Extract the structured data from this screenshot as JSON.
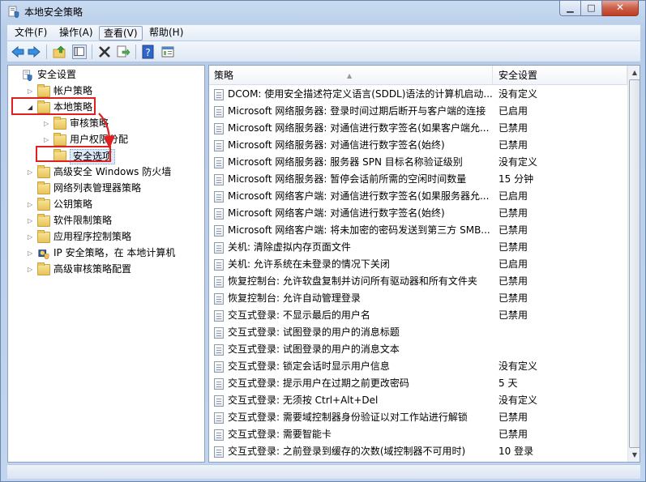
{
  "window": {
    "title": "本地安全策略"
  },
  "menu": [
    {
      "label": "文件(F)",
      "selected": false
    },
    {
      "label": "操作(A)",
      "selected": false
    },
    {
      "label": "查看(V)",
      "selected": true
    },
    {
      "label": "帮助(H)",
      "selected": false
    }
  ],
  "toolbar": {
    "icons": [
      "back-arrow-icon",
      "forward-arrow-icon",
      "up-folder-icon",
      "show-hide-tree-icon",
      "delete-icon",
      "export-list-icon",
      "help-icon",
      "properties-icon"
    ]
  },
  "tree": [
    {
      "label": "安全设置",
      "icon": "security-settings-icon",
      "arrow": "",
      "level": 0
    },
    {
      "label": "帐户策略",
      "icon": "folder-icon",
      "arrow": "collapsed",
      "level": 1
    },
    {
      "label": "本地策略",
      "icon": "folder-open-icon",
      "arrow": "expanded",
      "level": 1,
      "highlighted": true
    },
    {
      "label": "审核策略",
      "icon": "folder-icon",
      "arrow": "collapsed",
      "level": 2
    },
    {
      "label": "用户权限分配",
      "icon": "folder-icon",
      "arrow": "collapsed",
      "level": 2
    },
    {
      "label": "安全选项",
      "icon": "folder-open-icon",
      "arrow": "",
      "level": 2,
      "selected": true,
      "highlighted": true
    },
    {
      "label": "高级安全 Windows 防火墙",
      "icon": "folder-icon",
      "arrow": "collapsed",
      "level": 1
    },
    {
      "label": "网络列表管理器策略",
      "icon": "folder-icon",
      "arrow": "",
      "level": 1
    },
    {
      "label": "公钥策略",
      "icon": "folder-icon",
      "arrow": "collapsed",
      "level": 1
    },
    {
      "label": "软件限制策略",
      "icon": "folder-icon",
      "arrow": "collapsed",
      "level": 1
    },
    {
      "label": "应用程序控制策略",
      "icon": "folder-icon",
      "arrow": "collapsed",
      "level": 1
    },
    {
      "label": "IP 安全策略，在 本地计算机",
      "icon": "ip-security-icon",
      "arrow": "collapsed",
      "level": 1
    },
    {
      "label": "高级审核策略配置",
      "icon": "folder-icon",
      "arrow": "collapsed",
      "level": 1
    }
  ],
  "table": {
    "columns": [
      "策略",
      "安全设置"
    ],
    "rows": [
      [
        "DCOM: 使用安全描述符定义语言(SDDL)语法的计算机启动...",
        "没有定义"
      ],
      [
        "Microsoft 网络服务器: 登录时间过期后断开与客户端的连接",
        "已启用"
      ],
      [
        "Microsoft 网络服务器: 对通信进行数字签名(如果客户端允...",
        "已禁用"
      ],
      [
        "Microsoft 网络服务器: 对通信进行数字签名(始终)",
        "已禁用"
      ],
      [
        "Microsoft 网络服务器: 服务器 SPN 目标名称验证级别",
        "没有定义"
      ],
      [
        "Microsoft 网络服务器: 暂停会话前所需的空闲时间数量",
        "15 分钟"
      ],
      [
        "Microsoft 网络客户端: 对通信进行数字签名(如果服务器允...",
        "已启用"
      ],
      [
        "Microsoft 网络客户端: 对通信进行数字签名(始终)",
        "已禁用"
      ],
      [
        "Microsoft 网络客户端: 将未加密的密码发送到第三方 SMB...",
        "已禁用"
      ],
      [
        "关机: 清除虚拟内存页面文件",
        "已禁用"
      ],
      [
        "关机: 允许系统在未登录的情况下关闭",
        "已启用"
      ],
      [
        "恢复控制台: 允许软盘复制并访问所有驱动器和所有文件夹",
        "已禁用"
      ],
      [
        "恢复控制台: 允许自动管理登录",
        "已禁用"
      ],
      [
        "交互式登录: 不显示最后的用户名",
        "已禁用"
      ],
      [
        "交互式登录: 试图登录的用户的消息标题",
        ""
      ],
      [
        "交互式登录: 试图登录的用户的消息文本",
        ""
      ],
      [
        "交互式登录: 锁定会话时显示用户信息",
        "没有定义"
      ],
      [
        "交互式登录: 提示用户在过期之前更改密码",
        "5 天"
      ],
      [
        "交互式登录: 无须按 Ctrl+Alt+Del",
        "没有定义"
      ],
      [
        "交互式登录: 需要域控制器身份验证以对工作站进行解锁",
        "已禁用"
      ],
      [
        "交互式登录: 需要智能卡",
        "已禁用"
      ],
      [
        "交互式登录: 之前登录到缓存的次数(域控制器不可用时)",
        "10 登录"
      ]
    ]
  },
  "annotation": {
    "color": "#e02020"
  }
}
